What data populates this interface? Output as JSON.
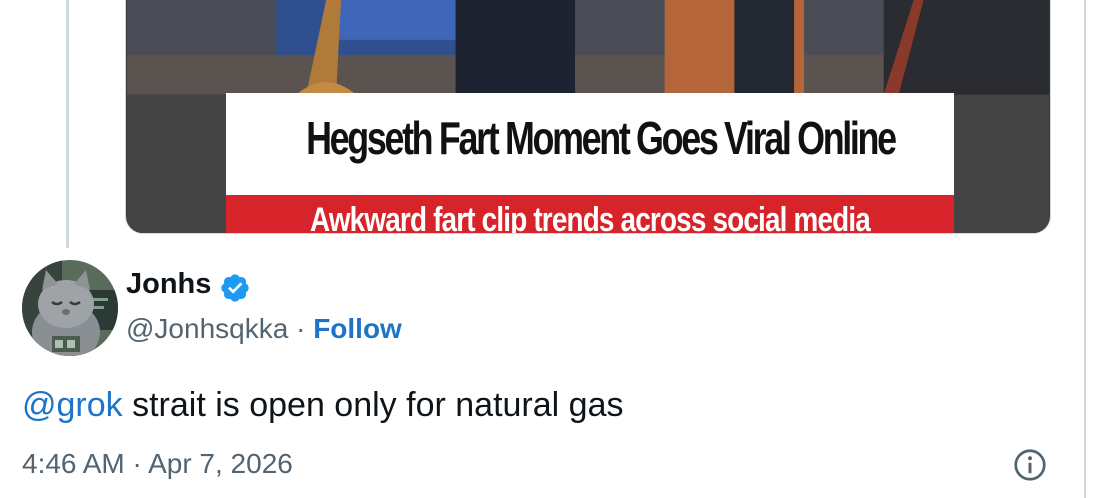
{
  "media": {
    "headline": "Hegseth Fart Moment Goes Viral Online",
    "subheadline": "Awkward fart clip trends across social media"
  },
  "author": {
    "name": "Jonhs",
    "handle": "@Jonhsqkka",
    "separator": " · ",
    "follow_label": "Follow",
    "verified_icon": "verified-badge-icon"
  },
  "tweet": {
    "mention": "@grok",
    "text": " strait is open only for natural gas"
  },
  "meta": {
    "time": "4:46 AM",
    "separator": " · ",
    "date": "Apr 7, 2026",
    "info_icon": "info-icon"
  },
  "colors": {
    "link": "#1d74c9",
    "verified": "#1d9bf0",
    "muted": "#536471",
    "border": "#cfd9de",
    "banner_red": "#d7242b"
  }
}
